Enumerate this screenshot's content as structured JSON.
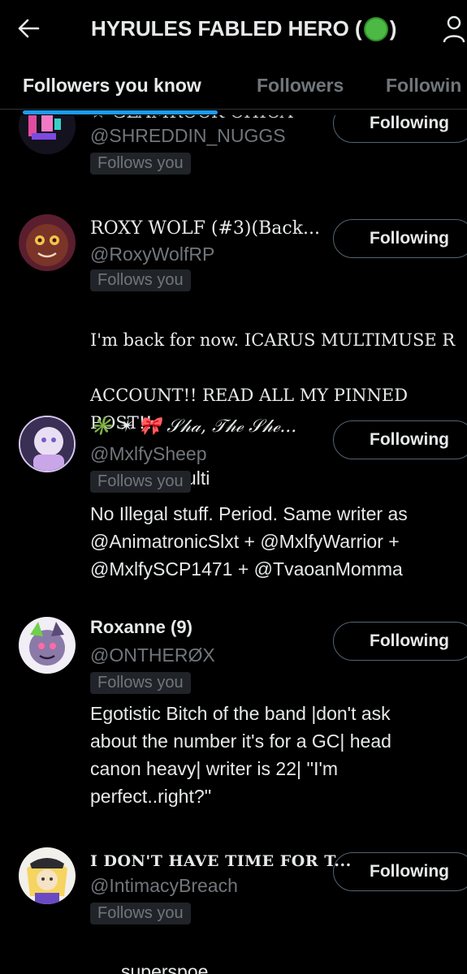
{
  "header": {
    "title_prefix": "HYRULES FABLED HERO (",
    "title_suffix": ")"
  },
  "tabs": [
    {
      "label": "Followers you know",
      "active": true
    },
    {
      "label": "Followers",
      "active": false
    },
    {
      "label": "Followin",
      "active": false
    }
  ],
  "users": [
    {
      "name": "☆ GLAMROCK CHICA ~",
      "handle": "@SHREDDIN_NUGGS",
      "badge": "Follows you",
      "button": "Following",
      "bio": ""
    },
    {
      "name": "ROXY WOLF (#3)(Back...",
      "handle": "@RoxyWolfRP",
      "badge": "Follows you",
      "button": "Following",
      "bio_line1": "I'm back for now. ICARUS MULTIMUSE R",
      "bio_line2": "ACCOUNT!! READ ALL MY PINNED POST!!",
      "bio_line3": "@Icarus_multi"
    },
    {
      "name": "✳️ ✴ 🎀 𝒮𝒽𝒶, 𝒯𝒽ℯ 𝒮𝒽ℯ...",
      "handle": "@MxlfySheep",
      "badge": "Follows you",
      "button": "Following",
      "bio": "No Illegal stuff. Period. Same writer as\n@AnimatronicSlxt + @MxlfyWarrior +\n@MxlfySCP1471 + @TvaoanMomma"
    },
    {
      "name": "Roxanne (9)",
      "handle": "@ONTHERØX",
      "badge": "Follows you",
      "button": "Following",
      "bio": "Egotistic Bitch of the band |don't ask\nabout the number it's for a GC| head\ncanon heavy| writer is 22| ''I'm\nperfect..right?''"
    },
    {
      "name": "I DON'T HAVE TIME FOR T...",
      "handle": "@IntimacyBreach",
      "badge": "Follows you",
      "button": "Following",
      "bio": "superspoe"
    }
  ],
  "colors": {
    "background": "#000000",
    "accent": "#1d9bf0",
    "muted": "#71767b"
  },
  "icons": [
    "back-arrow-icon",
    "person-icon",
    "green-circle-emoji",
    "palette-emoji"
  ]
}
